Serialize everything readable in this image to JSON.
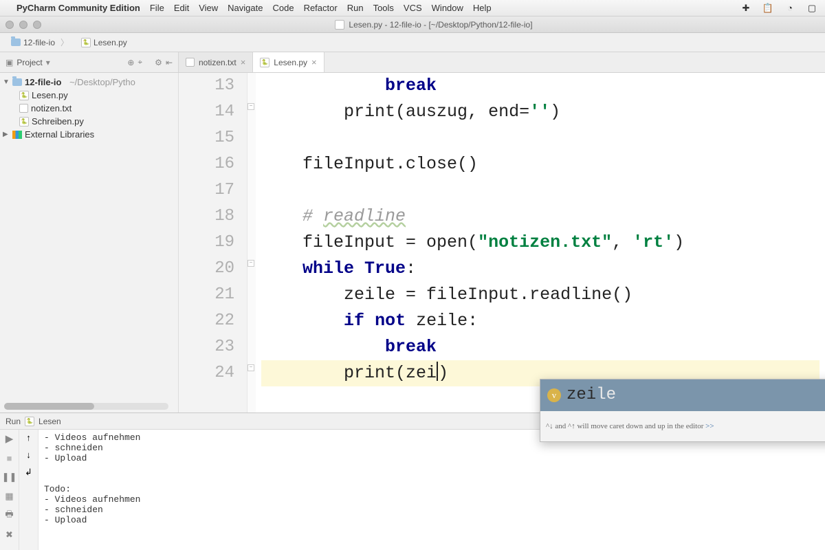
{
  "menubar": {
    "app_name": "PyCharm Community Edition",
    "items": [
      "File",
      "Edit",
      "View",
      "Navigate",
      "Code",
      "Refactor",
      "Run",
      "Tools",
      "VCS",
      "Window",
      "Help"
    ]
  },
  "window": {
    "title": "Lesen.py - 12-file-io - [~/Desktop/Python/12-file-io]"
  },
  "breadcrumb": {
    "items": [
      {
        "icon": "folder",
        "label": "12-file-io"
      },
      {
        "icon": "py",
        "label": "Lesen.py"
      }
    ]
  },
  "project_tool": {
    "label": "Project"
  },
  "tabs": [
    {
      "icon": "txt",
      "label": "notizen.txt",
      "active": false
    },
    {
      "icon": "py",
      "label": "Lesen.py",
      "active": true
    }
  ],
  "tree": {
    "root": {
      "name": "12-file-io",
      "path": "~/Desktop/Pytho"
    },
    "files": [
      "Lesen.py",
      "notizen.txt",
      "Schreiben.py"
    ],
    "external": "External Libraries"
  },
  "editor": {
    "first_line_no": 13,
    "lines": [
      {
        "n": 13,
        "indent": "            ",
        "tokens": [
          {
            "t": "break",
            "c": "kw"
          }
        ]
      },
      {
        "n": 14,
        "indent": "        ",
        "tokens": [
          {
            "t": "print",
            "c": "fn"
          },
          {
            "t": "(auszug, end=",
            "c": "op"
          },
          {
            "t": "''",
            "c": "str"
          },
          {
            "t": ")",
            "c": "op"
          }
        ]
      },
      {
        "n": 15,
        "indent": "",
        "tokens": []
      },
      {
        "n": 16,
        "indent": "    ",
        "tokens": [
          {
            "t": "fileInput.close()",
            "c": "fn"
          }
        ]
      },
      {
        "n": 17,
        "indent": "",
        "tokens": []
      },
      {
        "n": 18,
        "indent": "    ",
        "tokens": [
          {
            "t": "# ",
            "c": "cm"
          },
          {
            "t": "readline",
            "c": "cm underline"
          }
        ]
      },
      {
        "n": 19,
        "indent": "    ",
        "tokens": [
          {
            "t": "fileInput = open(",
            "c": "fn"
          },
          {
            "t": "\"notizen.txt\"",
            "c": "str"
          },
          {
            "t": ", ",
            "c": "op"
          },
          {
            "t": "'rt'",
            "c": "str"
          },
          {
            "t": ")",
            "c": "op"
          }
        ]
      },
      {
        "n": 20,
        "indent": "    ",
        "tokens": [
          {
            "t": "while",
            "c": "kw"
          },
          {
            "t": " ",
            "c": "op"
          },
          {
            "t": "True",
            "c": "kw"
          },
          {
            "t": ":",
            "c": "op"
          }
        ]
      },
      {
        "n": 21,
        "indent": "        ",
        "tokens": [
          {
            "t": "zeile = fileInput.readline()",
            "c": "fn"
          }
        ]
      },
      {
        "n": 22,
        "indent": "        ",
        "tokens": [
          {
            "t": "if",
            "c": "kw"
          },
          {
            "t": " ",
            "c": "op"
          },
          {
            "t": "not",
            "c": "kw"
          },
          {
            "t": " zeile:",
            "c": "fn"
          }
        ]
      },
      {
        "n": 23,
        "indent": "            ",
        "tokens": [
          {
            "t": "break",
            "c": "kw"
          }
        ]
      },
      {
        "n": 24,
        "indent": "        ",
        "tokens": [
          {
            "t": "print(zei",
            "c": "fn"
          },
          {
            "t": "CARET",
            "c": "caret"
          },
          {
            "t": ")",
            "c": "fn"
          }
        ],
        "hl": true
      }
    ]
  },
  "autocomplete": {
    "typed": "zei",
    "rest": "le",
    "hint_prefix": "^↓ and ^↑ will move caret down and up in the editor ",
    "hint_link": ">>"
  },
  "run": {
    "header_prefix": "Run",
    "header_config": "Lesen",
    "output": "- Videos aufnehmen\n- schneiden\n- Upload\n\n\nTodo:\n- Videos aufnehmen\n- schneiden\n- Upload"
  }
}
